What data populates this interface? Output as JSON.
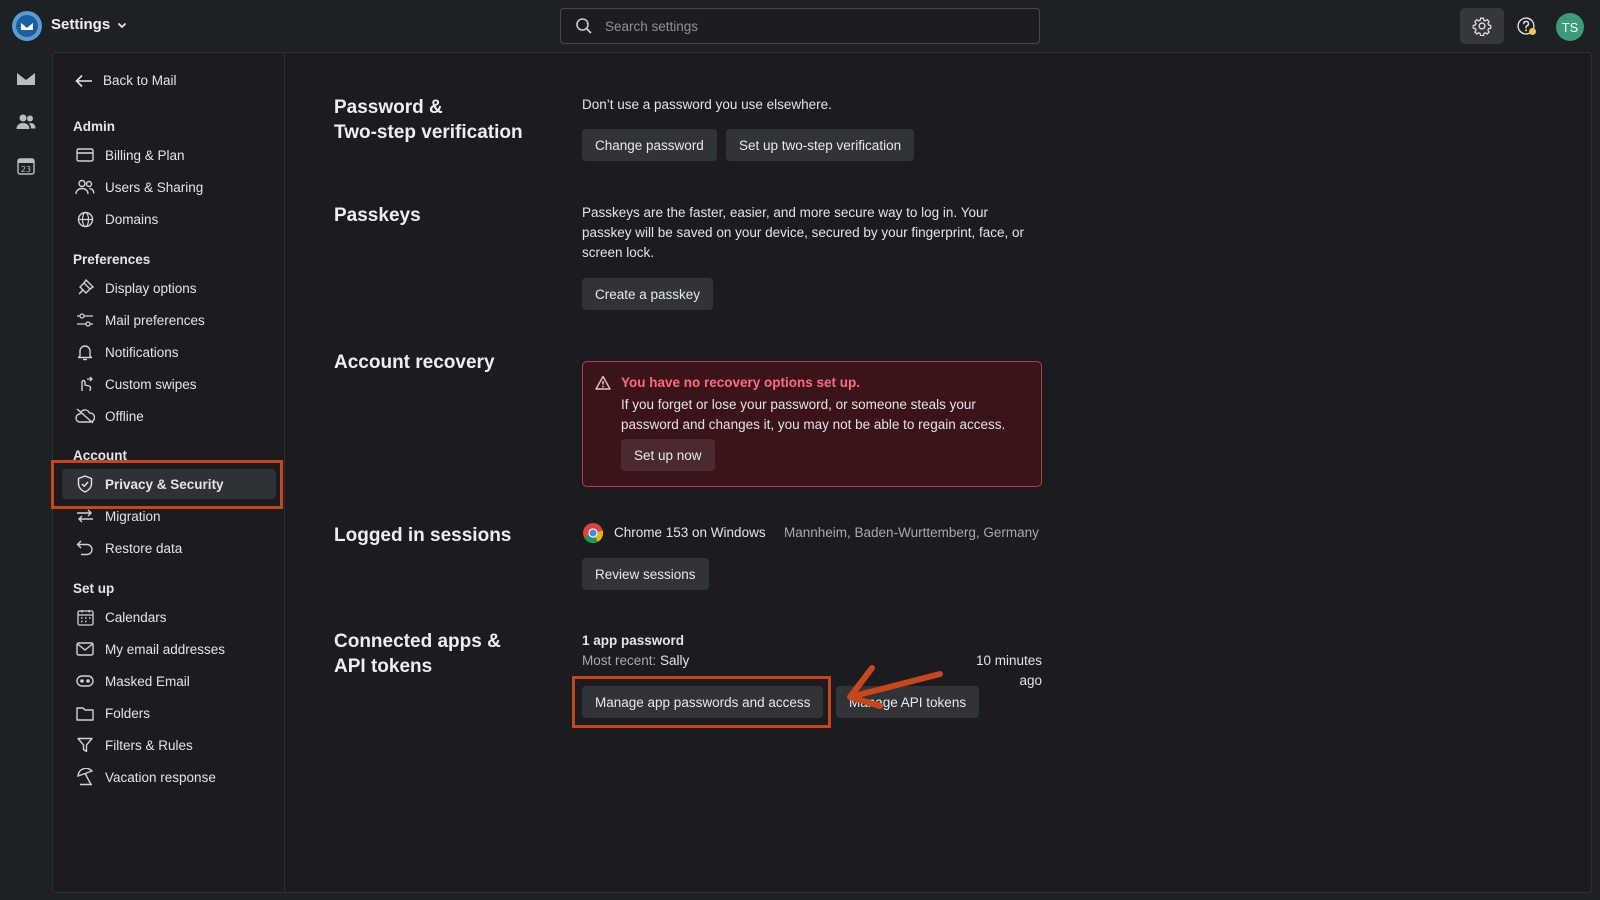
{
  "app": {
    "title": "Settings",
    "avatar_initials": "TS"
  },
  "search": {
    "placeholder": "Search settings"
  },
  "sidebar": {
    "back_label": "Back to Mail",
    "groups": {
      "admin": "Admin",
      "preferences": "Preferences",
      "account": "Account",
      "setup": "Set up"
    },
    "items": {
      "billing": "Billing & Plan",
      "users": "Users & Sharing",
      "domains": "Domains",
      "display": "Display options",
      "mail_prefs": "Mail preferences",
      "notifications": "Notifications",
      "swipes": "Custom swipes",
      "offline": "Offline",
      "privacy": "Privacy & Security",
      "migration": "Migration",
      "restore": "Restore data",
      "calendars": "Calendars",
      "addresses": "My email addresses",
      "masked": "Masked Email",
      "folders": "Folders",
      "filters": "Filters & Rules",
      "vacation": "Vacation response"
    },
    "active_item": "Privacy & Security"
  },
  "sections": {
    "password": {
      "title_line1": "Password &",
      "title_line2": "Two-step verification",
      "description": "Don’t use a password you use elsewhere.",
      "change_button": "Change password",
      "twostep_button": "Set up two-step verification"
    },
    "passkeys": {
      "title": "Passkeys",
      "description_line1": "Passkeys are the faster, easier, and more secure way to log in. Your",
      "description_line2": "passkey will be saved on your device, secured by your fingerprint, face, or",
      "description_line3": "screen lock.",
      "create_button": "Create a passkey"
    },
    "recovery": {
      "title": "Account recovery",
      "alert_title": "You have no recovery options set up.",
      "alert_line1": "If you forget or lose your password, or someone steals your",
      "alert_line2": "password and changes it, you may not be able to regain access.",
      "setup_button": "Set up now"
    },
    "sessions": {
      "title": "Logged in sessions",
      "browser": "Chrome 153 on Windows",
      "location": "Mannheim, Baden-Wurttemberg, Germany",
      "review_button": "Review sessions"
    },
    "connected": {
      "title_line1": "Connected apps &",
      "title_line2": "API tokens",
      "count": "1 app password",
      "recent_label": "Most recent:",
      "recent_name": "Sally",
      "recent_time": "10 minutes ago",
      "manage_passwords_button": "Manage app passwords and access",
      "manage_tokens_button": "Manage API tokens"
    }
  },
  "colors": {
    "highlight": "#c8461b",
    "alert_text": "#ff6b7d",
    "alert_bg": "#3a1419",
    "avatar": "#3b9b7a"
  }
}
